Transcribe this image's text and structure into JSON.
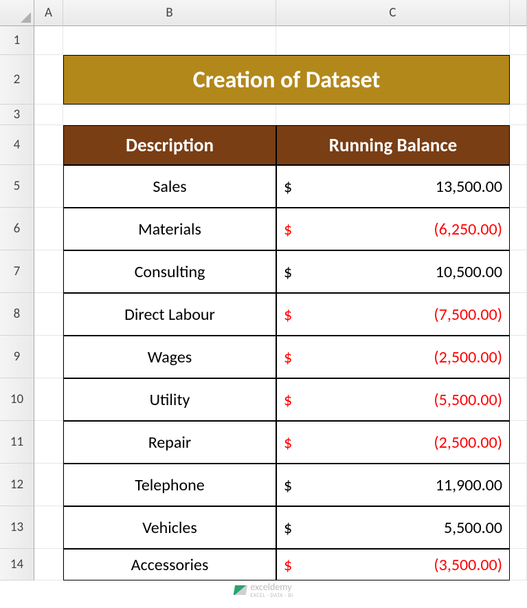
{
  "columns": [
    "A",
    "B",
    "C"
  ],
  "row_numbers": [
    1,
    2,
    3,
    4,
    5,
    6,
    7,
    8,
    9,
    10,
    11,
    12,
    13,
    14
  ],
  "title": "Creation of Dataset",
  "headers": {
    "description": "Description",
    "balance": "Running Balance"
  },
  "currency": "$",
  "rows": [
    {
      "desc": "Sales",
      "value": "13,500.00",
      "display": "13,500.00",
      "neg": false
    },
    {
      "desc": "Materials",
      "value": "-6,250.00",
      "display": "(6,250.00)",
      "neg": true
    },
    {
      "desc": "Consulting",
      "value": "10,500.00",
      "display": "10,500.00",
      "neg": false
    },
    {
      "desc": "Direct Labour",
      "value": "-7,500.00",
      "display": "(7,500.00)",
      "neg": true
    },
    {
      "desc": "Wages",
      "value": "-2,500.00",
      "display": "(2,500.00)",
      "neg": true
    },
    {
      "desc": "Utility",
      "value": "-5,500.00",
      "display": "(5,500.00)",
      "neg": true
    },
    {
      "desc": "Repair",
      "value": "-2,500.00",
      "display": "(2,500.00)",
      "neg": true
    },
    {
      "desc": "Telephone",
      "value": "11,900.00",
      "display": "11,900.00",
      "neg": false
    },
    {
      "desc": "Vehicles",
      "value": "5,500.00",
      "display": "5,500.00",
      "neg": false
    },
    {
      "desc": "Accessories",
      "value": "-3,500.00",
      "display": "(3,500.00)",
      "neg": true
    }
  ],
  "watermark": {
    "main": "exceldemy",
    "sub": "EXCEL · DATA · BI"
  },
  "chart_data": {
    "type": "table",
    "title": "Creation of Dataset",
    "columns": [
      "Description",
      "Running Balance"
    ],
    "rows": [
      [
        "Sales",
        13500.0
      ],
      [
        "Materials",
        -6250.0
      ],
      [
        "Consulting",
        10500.0
      ],
      [
        "Direct Labour",
        -7500.0
      ],
      [
        "Wages",
        -2500.0
      ],
      [
        "Utility",
        -5500.0
      ],
      [
        "Repair",
        -2500.0
      ],
      [
        "Telephone",
        11900.0
      ],
      [
        "Vehicles",
        5500.0
      ],
      [
        "Accessories",
        -3500.0
      ]
    ]
  }
}
